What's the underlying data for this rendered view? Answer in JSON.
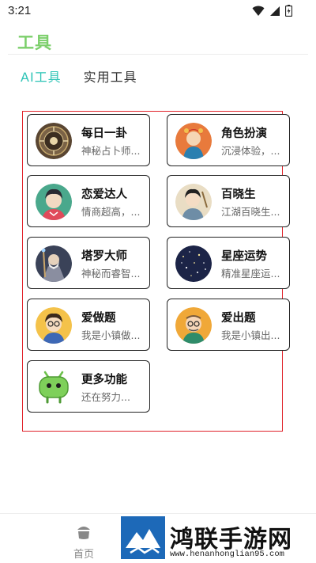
{
  "status_bar": {
    "time": "3:21"
  },
  "header": {
    "title": "工具"
  },
  "tabs": [
    {
      "label": "AI工具",
      "active": true
    },
    {
      "label": "实用工具",
      "active": false
    }
  ],
  "cards": [
    {
      "name": "每日一卦",
      "desc": "神秘占卜师...",
      "icon": "bagua-compass-avatar"
    },
    {
      "name": "角色扮演",
      "desc": "沉浸体验，...",
      "icon": "opera-character-avatar"
    },
    {
      "name": "恋爱达人",
      "desc": "情商超高，...",
      "icon": "handsome-man-avatar"
    },
    {
      "name": "百晓生",
      "desc": "江湖百晓生...",
      "icon": "scholar-avatar"
    },
    {
      "name": "塔罗大师",
      "desc": "神秘而睿智...",
      "icon": "wizard-avatar"
    },
    {
      "name": "星座运势",
      "desc": "精准星座运...",
      "icon": "starry-sky-avatar"
    },
    {
      "name": "爱做题",
      "desc": "我是小镇做...",
      "icon": "student-boy-avatar"
    },
    {
      "name": "爱出题",
      "desc": "我是小镇出...",
      "icon": "teacher-avatar"
    },
    {
      "name": "更多功能",
      "desc": "还在努力...",
      "icon": "green-robot-avatar"
    }
  ],
  "bottom_nav": {
    "home_label": "首页"
  },
  "watermark": {
    "text": "鸿联手游网",
    "url": "www.henanhonglian95.com"
  },
  "colors": {
    "title": "#7ccf6b",
    "active_tab": "#2ec4b6",
    "highlight_frame": "#e0222a",
    "watermark_logo": "#1d69b8"
  }
}
